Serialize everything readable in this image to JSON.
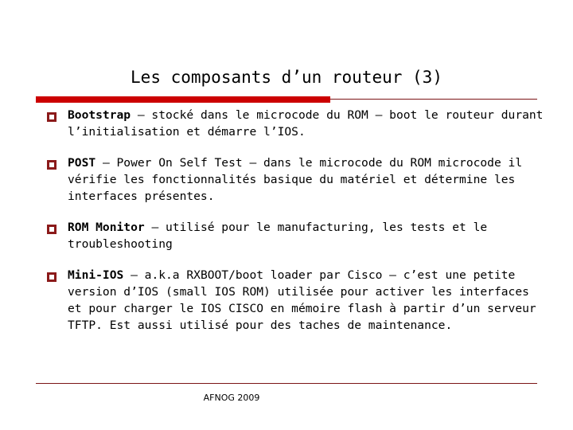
{
  "slide": {
    "title": "Les composants d’un routeur (3)",
    "accent_color": "#cc0000",
    "rule_color": "#7b1416",
    "bullet_color": "#8b1a1a",
    "background_color": "#ffffff",
    "text_color": "#000000",
    "bullets": [
      {
        "lead": "Bootstrap",
        "rest": " – stocké dans le microcode du ROM – boot le routeur durant l’initialisation et démarre l’IOS.",
        "marker": "hollow-square-bullet"
      },
      {
        "lead": "POST",
        "rest": " – Power On Self Test – dans le microcode du ROM microcode il vérifie les fonctionnalités basique du matériel et détermine les interfaces présentes.",
        "marker": "hollow-square-bullet"
      },
      {
        "lead": "ROM Monitor",
        "rest": " – utilisé pour le manufacturing, les tests et le troubleshooting",
        "marker": "hollow-square-bullet"
      },
      {
        "lead": "Mini-IOS",
        "rest": " – a.k.a RXBOOT/boot loader par Cisco – c’est une petite version d’IOS (small IOS ROM) utilisée pour activer les interfaces et pour charger le IOS CISCO en mémoire flash à partir d’un serveur TFTP. Est aussi utilisé pour des taches de maintenance.",
        "marker": "hollow-square-bullet"
      }
    ],
    "footer": "AFNOG 2009"
  }
}
